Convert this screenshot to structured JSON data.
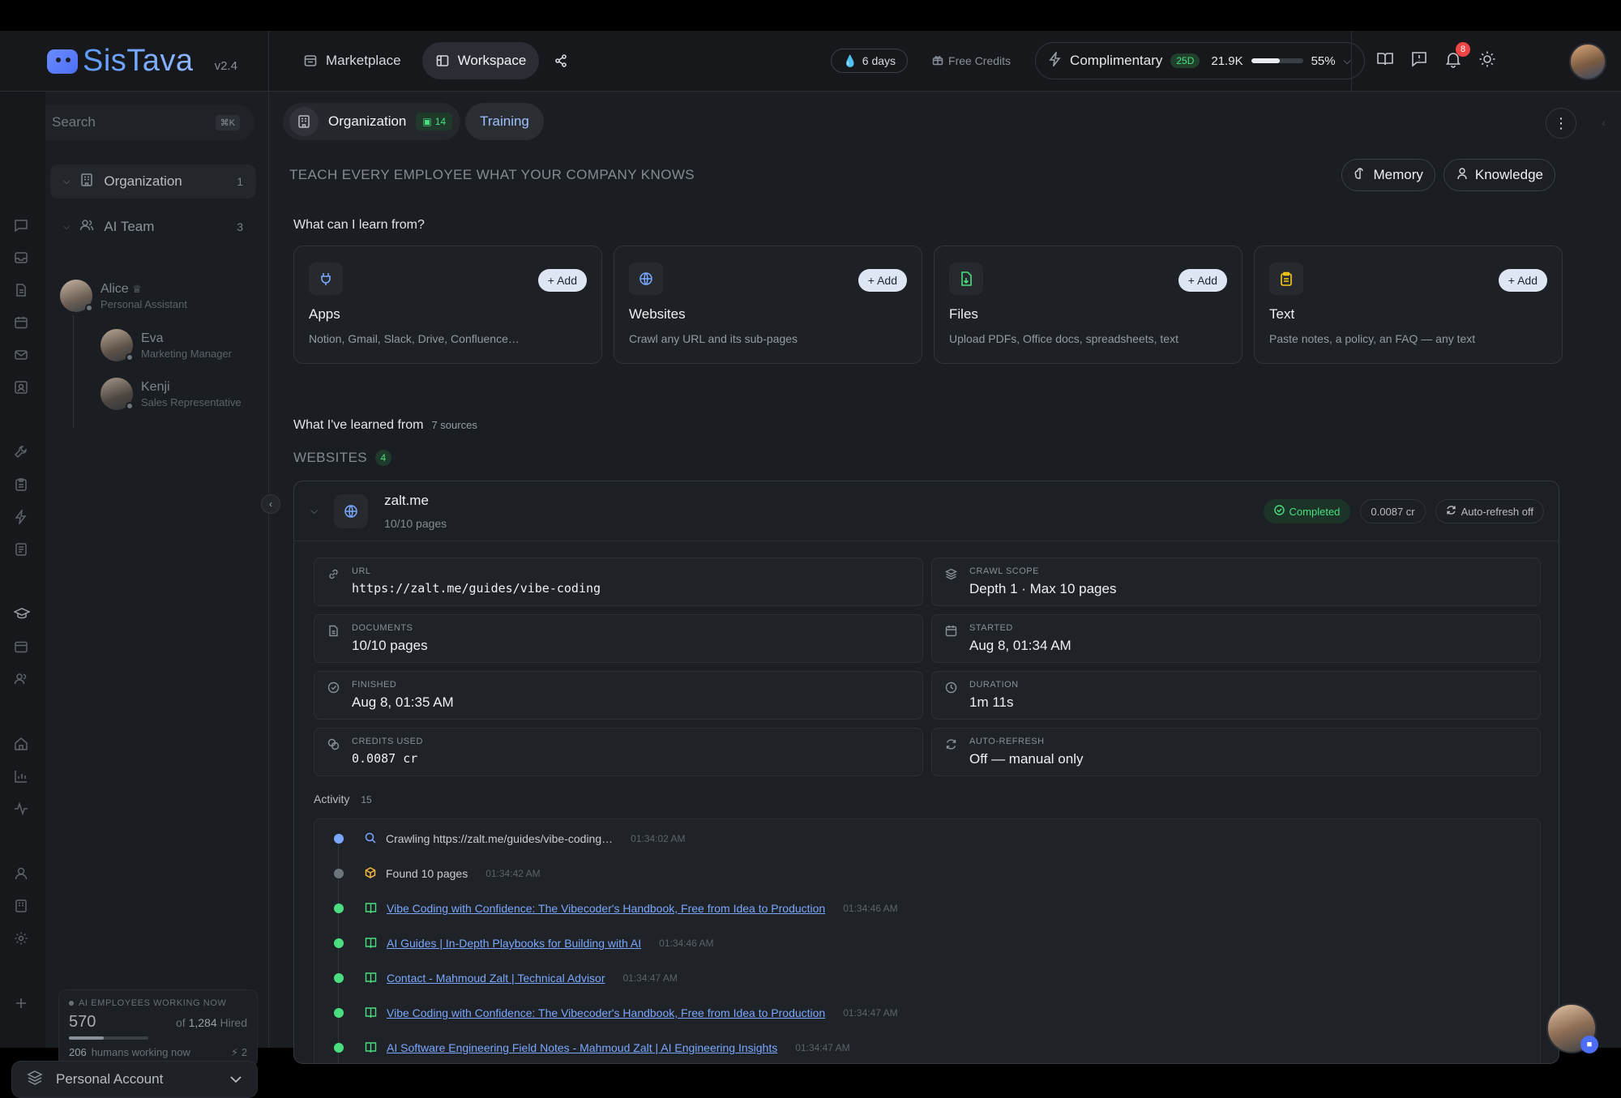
{
  "brand": {
    "name": "SisTava",
    "version": "v2.4"
  },
  "nav": {
    "marketplace": "Marketplace",
    "workspace": "Workspace"
  },
  "status": {
    "days": "6 days",
    "free_credits": "Free Credits",
    "plan": "Complimentary",
    "plan_badge": "25D",
    "tokens": "21.9K",
    "usage_percent": "55%",
    "usage_fraction": 0.55,
    "notifications": "8"
  },
  "sidebar": {
    "search_placeholder": "Search",
    "search_kbd": "⌘K",
    "org": {
      "label": "Organization",
      "count": "1"
    },
    "team": {
      "label": "AI Team",
      "count": "3"
    },
    "people": [
      {
        "name": "Alice",
        "role": "Personal Assistant"
      },
      {
        "name": "Eva",
        "role": "Marketing Manager"
      },
      {
        "name": "Kenji",
        "role": "Sales Representative"
      }
    ],
    "working": {
      "label": "AI EMPLOYEES WORKING NOW",
      "count": "570",
      "of_prefix": "of",
      "hired": "1,284",
      "hired_suffix": "Hired",
      "progress_fraction": 0.44,
      "humans": "206",
      "humans_label": "humans working now",
      "zap": "2"
    },
    "account": "Personal Account"
  },
  "tabs": {
    "org": "Organization",
    "org_badge": "14",
    "training": "Training"
  },
  "main": {
    "teach": "TEACH EVERY EMPLOYEE WHAT YOUR COMPANY KNOWS",
    "memory": "Memory",
    "knowledge": "Knowledge",
    "learn_heading": "What can I learn from?",
    "add_label": "+ Add",
    "cards": [
      {
        "title": "Apps",
        "desc": "Notion, Gmail, Slack, Drive, Confluence…",
        "icon": "plug-icon"
      },
      {
        "title": "Websites",
        "desc": "Crawl any URL and its sub-pages",
        "icon": "globe-icon"
      },
      {
        "title": "Files",
        "desc": "Upload PDFs, Office docs, spreadsheets, text",
        "icon": "file-icon"
      },
      {
        "title": "Text",
        "desc": "Paste notes, a policy, an FAQ — any text",
        "icon": "clipboard-icon"
      }
    ],
    "learned_heading": "What I've learned from",
    "learned_sources": "7 sources",
    "websites_label": "WEBSITES",
    "websites_count": "4"
  },
  "site": {
    "name": "zalt.me",
    "pages": "10/10 pages",
    "status": "Completed",
    "cost": "0.0087 cr",
    "refresh": "Auto-refresh off",
    "details": [
      {
        "label": "URL",
        "value": "https://zalt.me/guides/vibe-coding",
        "mono": true
      },
      {
        "label": "CRAWL SCOPE",
        "value": "Depth 1 · Max 10 pages",
        "mono": false
      },
      {
        "label": "DOCUMENTS",
        "value": "10/10 pages",
        "mono": false
      },
      {
        "label": "STARTED",
        "value": "Aug 8, 01:34 AM",
        "mono": false
      },
      {
        "label": "FINISHED",
        "value": "Aug 8, 01:35 AM",
        "mono": false
      },
      {
        "label": "DURATION",
        "value": "1m 11s",
        "mono": false
      },
      {
        "label": "CREDITS USED",
        "value": "0.0087 cr",
        "mono": true
      },
      {
        "label": "AUTO-REFRESH",
        "value": "Off — manual only",
        "mono": false
      }
    ],
    "activity_label": "Activity",
    "activity_count": "15",
    "activity": [
      {
        "text": "Crawling https://zalt.me/guides/vibe-coding…",
        "time": "01:34:02 AM",
        "kind": "search",
        "link": false
      },
      {
        "text": "Found 10 pages",
        "time": "01:34:42 AM",
        "kind": "found",
        "link": false
      },
      {
        "text": "Vibe Coding with Confidence: The Vibecoder's Handbook, Free from Idea to Production",
        "time": "01:34:46 AM",
        "kind": "page",
        "link": true
      },
      {
        "text": "AI Guides | In-Depth Playbooks for Building with AI",
        "time": "01:34:46 AM",
        "kind": "page",
        "link": true
      },
      {
        "text": "Contact - Mahmoud Zalt | Technical Advisor",
        "time": "01:34:47 AM",
        "kind": "page",
        "link": true
      },
      {
        "text": "Vibe Coding with Confidence: The Vibecoder's Handbook, Free from Idea to Production",
        "time": "01:34:47 AM",
        "kind": "page",
        "link": true
      },
      {
        "text": "AI Software Engineering Field Notes - Mahmoud Zalt | AI Engineering Insights",
        "time": "01:34:47 AM",
        "kind": "page",
        "link": true
      }
    ]
  },
  "colors": {
    "accent": "#4c6ef5",
    "success": "#4ade80",
    "link": "#7aa7ff",
    "danger": "#ef4444"
  }
}
